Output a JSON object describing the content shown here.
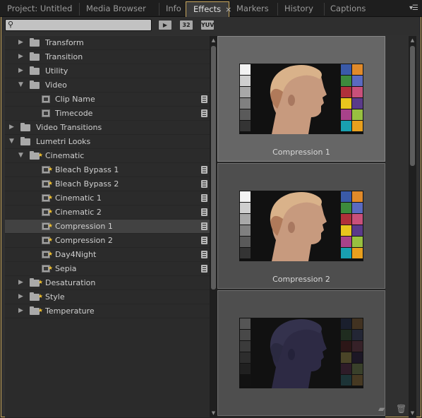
{
  "tabs": [
    {
      "label": "Project: Untitled"
    },
    {
      "label": "Media Browser"
    },
    {
      "label": "Info"
    },
    {
      "label": "Effects",
      "active": true,
      "close": "×"
    },
    {
      "label": "Markers"
    },
    {
      "label": "History"
    },
    {
      "label": "Captions"
    }
  ],
  "panel_menu": "▾☰",
  "search": {
    "value": "",
    "placeholder": ""
  },
  "toolbar_buttons": [
    "▶",
    "32",
    "YUV"
  ],
  "tree": [
    {
      "label": "Transform",
      "indent": 1,
      "kind": "folder",
      "expanded": false
    },
    {
      "label": "Transition",
      "indent": 1,
      "kind": "folder",
      "expanded": false
    },
    {
      "label": "Utility",
      "indent": 1,
      "kind": "folder",
      "expanded": false
    },
    {
      "label": "Video",
      "indent": 1,
      "kind": "folder",
      "expanded": true
    },
    {
      "label": "Clip Name",
      "indent": 2,
      "kind": "effect"
    },
    {
      "label": "Timecode",
      "indent": 2,
      "kind": "effect"
    },
    {
      "label": "Video Transitions",
      "indent": 0,
      "kind": "folder",
      "expanded": false
    },
    {
      "label": "Lumetri Looks",
      "indent": 0,
      "kind": "folder",
      "expanded": true
    },
    {
      "label": "Cinematic",
      "indent": 1,
      "kind": "folder-star",
      "expanded": true
    },
    {
      "label": "Bleach Bypass 1",
      "indent": 2,
      "kind": "effect-star"
    },
    {
      "label": "Bleach Bypass 2",
      "indent": 2,
      "kind": "effect-star"
    },
    {
      "label": "Cinematic 1",
      "indent": 2,
      "kind": "effect-star"
    },
    {
      "label": "Cinematic 2",
      "indent": 2,
      "kind": "effect-star"
    },
    {
      "label": "Compression 1",
      "indent": 2,
      "kind": "effect-star",
      "selected": true
    },
    {
      "label": "Compression 2",
      "indent": 2,
      "kind": "effect-star"
    },
    {
      "label": "Day4Night",
      "indent": 2,
      "kind": "effect-star"
    },
    {
      "label": "Sepia",
      "indent": 2,
      "kind": "effect-star"
    },
    {
      "label": "Desaturation",
      "indent": 1,
      "kind": "folder-star",
      "expanded": false
    },
    {
      "label": "Style",
      "indent": 1,
      "kind": "folder-star",
      "expanded": false
    },
    {
      "label": "Temperature",
      "indent": 1,
      "kind": "folder-star",
      "expanded": false
    }
  ],
  "previews": [
    {
      "title": "Compression 1",
      "selected": true,
      "dark": false
    },
    {
      "title": "Compression 2",
      "selected": false,
      "dark": false
    },
    {
      "title": "",
      "selected": false,
      "dark": true
    }
  ],
  "swatch_colors": {
    "gray": [
      "#f2f2f2",
      "#cfcfcf",
      "#a8a8a8",
      "#808080",
      "#5a5a5a",
      "#343434"
    ],
    "color_a": [
      "#3a5aa8",
      "#3d8a3c",
      "#b0303a",
      "#e8c51e",
      "#a8428a",
      "#19a0b0"
    ],
    "color_b": [
      "#e08a2a",
      "#5a6ac0",
      "#c8507a",
      "#5a3a8a",
      "#98c040",
      "#e8a01e"
    ]
  },
  "footer": {
    "new_bin_icon": "new-custom-bin-icon",
    "delete_icon": "delete-icon"
  }
}
